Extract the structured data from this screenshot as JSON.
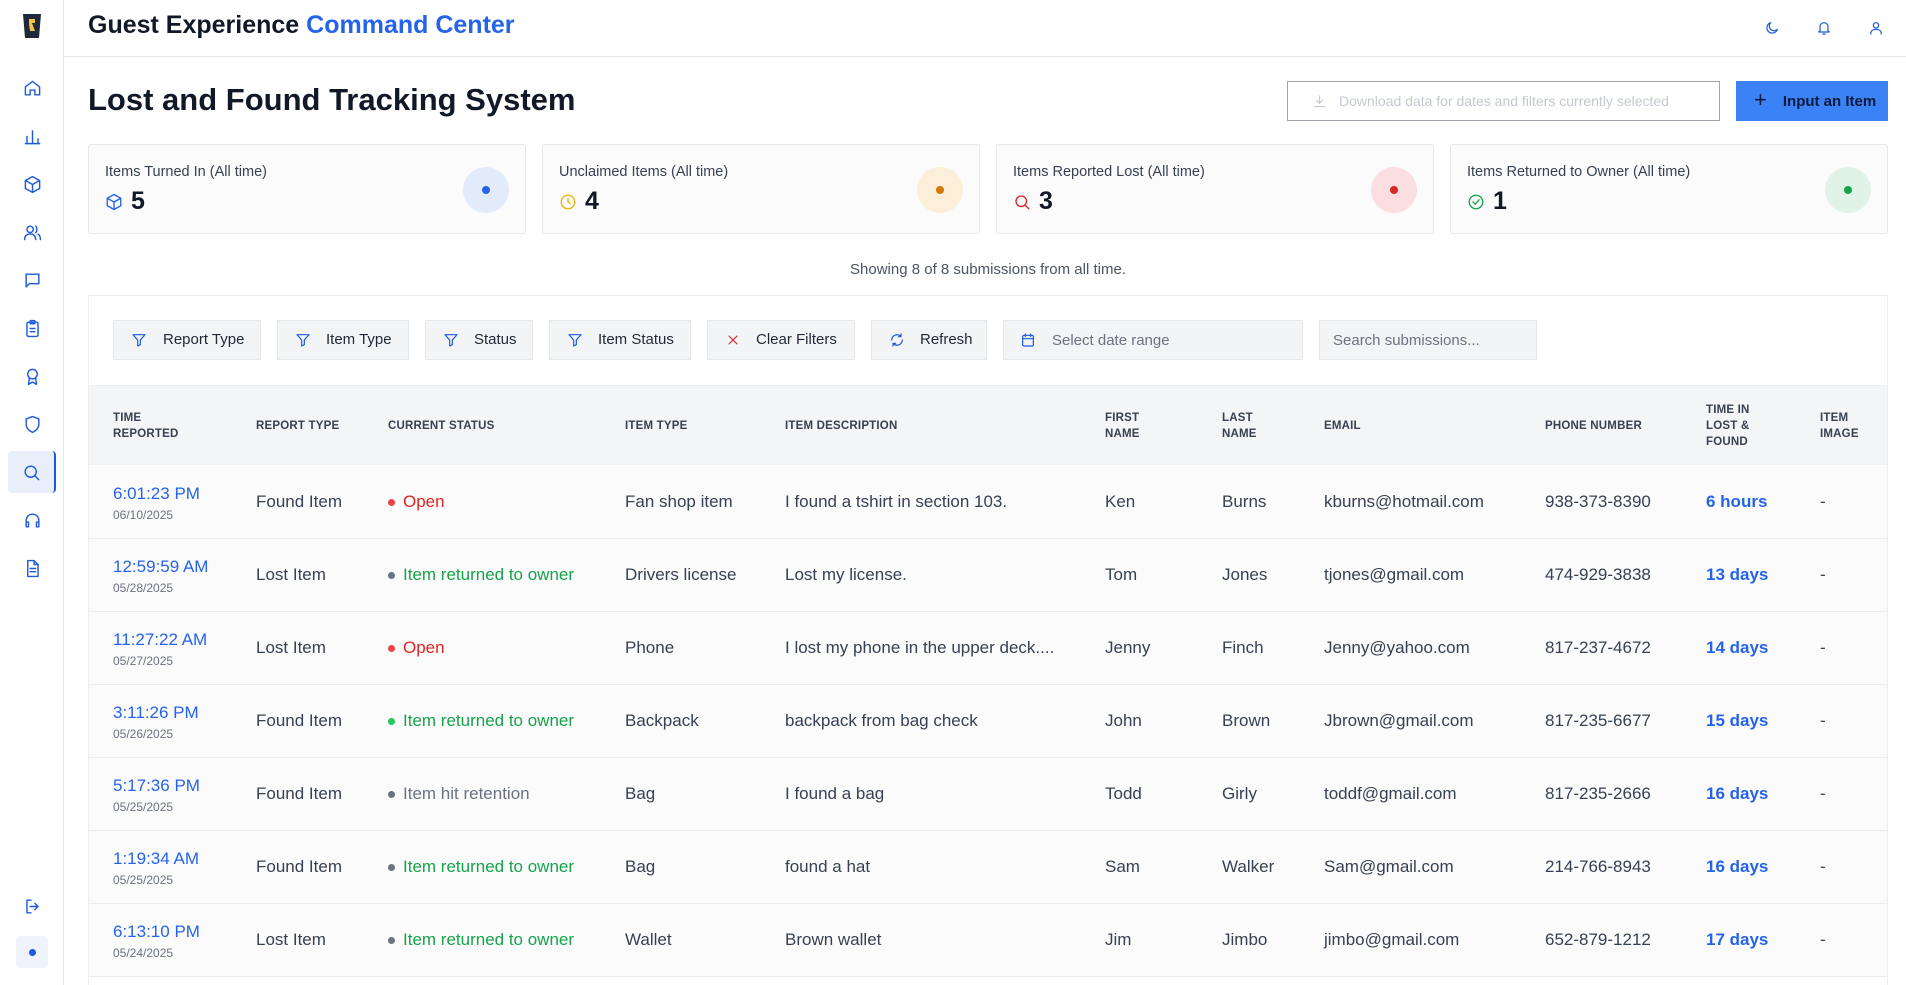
{
  "header": {
    "title_part1": "Guest Experience",
    "title_part2": "Command Center"
  },
  "sidebar": {
    "items": [
      {
        "icon": "home-icon"
      },
      {
        "icon": "bar-chart-icon"
      },
      {
        "icon": "box-icon"
      },
      {
        "icon": "users-icon"
      },
      {
        "icon": "message-icon"
      },
      {
        "icon": "clipboard-icon"
      },
      {
        "icon": "award-icon"
      },
      {
        "icon": "shield-icon"
      },
      {
        "icon": "search-icon",
        "active": true
      },
      {
        "icon": "headphones-icon"
      },
      {
        "icon": "file-text-icon"
      }
    ],
    "logout_icon": "logout-icon"
  },
  "page": {
    "title": "Lost and Found Tracking System",
    "download_label": "Download data for dates and filters currently selected",
    "input_item_label": "Input an Item"
  },
  "stats": [
    {
      "label": "Items Turned In (All time)",
      "value": "5",
      "color": "#2563eb",
      "icon": "box-icon"
    },
    {
      "label": "Unclaimed Items (All time)",
      "value": "4",
      "color": "#eab308",
      "icon": "clock-icon"
    },
    {
      "label": "Items Reported Lost (All time)",
      "value": "3",
      "color": "#dc2626",
      "icon": "search-icon"
    },
    {
      "label": "Items Returned to Owner (All time)",
      "value": "1",
      "color": "#16a34a",
      "icon": "check-circle-icon"
    }
  ],
  "showing_text": "Showing 8 of 8 submissions from all time.",
  "filters": {
    "report_type": "Report Type",
    "item_type": "Item Type",
    "status": "Status",
    "item_status": "Item Status",
    "clear": "Clear Filters",
    "refresh": "Refresh",
    "date_placeholder": "Select date range",
    "search_placeholder": "Search submissions..."
  },
  "table": {
    "headers": {
      "time": "Time Reported",
      "report_type": "Report Type",
      "status": "Current Status",
      "item_type": "Item Type",
      "description": "Item Description",
      "first": "First Name",
      "last": "Last Name",
      "email": "Email",
      "phone": "Phone Number",
      "time_in": "Time in Lost & Found",
      "image": "Item Image"
    },
    "rows": [
      {
        "time": "6:01:23 PM",
        "date": "06/10/2025",
        "report_type": "Found Item",
        "status": "Open",
        "status_color": "#dc2626",
        "dot_color": "#ef4444",
        "item_type": "Fan shop item",
        "description": "I found a tshirt in section 103.",
        "first": "Ken",
        "last": "Burns",
        "email": "kburns@hotmail.com",
        "phone": "938-373-8390",
        "time_in": "6 hours",
        "image": "-"
      },
      {
        "time": "12:59:59 AM",
        "date": "05/28/2025",
        "report_type": "Lost Item",
        "status": "Item returned to owner",
        "status_color": "#16a34a",
        "dot_color": "#6b7280",
        "item_type": "Drivers license",
        "description": "Lost my license.",
        "first": "Tom",
        "last": "Jones",
        "email": "tjones@gmail.com",
        "phone": "474-929-3838",
        "time_in": "13 days",
        "image": "-"
      },
      {
        "time": "11:27:22 AM",
        "date": "05/27/2025",
        "report_type": "Lost Item",
        "status": "Open",
        "status_color": "#dc2626",
        "dot_color": "#ef4444",
        "item_type": "Phone",
        "description": "I lost my phone in the upper deck....",
        "first": "Jenny",
        "last": "Finch",
        "email": "Jenny@yahoo.com",
        "phone": "817-237-4672",
        "time_in": "14 days",
        "image": "-"
      },
      {
        "time": "3:11:26 PM",
        "date": "05/26/2025",
        "report_type": "Found Item",
        "status": "Item returned to owner",
        "status_color": "#16a34a",
        "dot_color": "#22c55e",
        "item_type": "Backpack",
        "description": "backpack from bag check",
        "first": "John",
        "last": "Brown",
        "email": "Jbrown@gmail.com",
        "phone": "817-235-6677",
        "time_in": "15 days",
        "image": "-"
      },
      {
        "time": "5:17:36 PM",
        "date": "05/25/2025",
        "report_type": "Found Item",
        "status": "Item hit retention",
        "status_color": "#6b7280",
        "dot_color": "#6b7280",
        "item_type": "Bag",
        "description": "I found a bag",
        "first": "Todd",
        "last": "Girly",
        "email": "toddf@gmail.com",
        "phone": "817-235-2666",
        "time_in": "16 days",
        "image": "-"
      },
      {
        "time": "1:19:34 AM",
        "date": "05/25/2025",
        "report_type": "Found Item",
        "status": "Item returned to owner",
        "status_color": "#16a34a",
        "dot_color": "#6b7280",
        "item_type": "Bag",
        "description": "found a hat",
        "first": "Sam",
        "last": "Walker",
        "email": "Sam@gmail.com",
        "phone": "214-766-8943",
        "time_in": "16 days",
        "image": "-"
      },
      {
        "time": "6:13:10 PM",
        "date": "05/24/2025",
        "report_type": "Lost Item",
        "status": "Item returned to owner",
        "status_color": "#16a34a",
        "dot_color": "#6b7280",
        "item_type": "Wallet",
        "description": "Brown wallet",
        "first": "Jim",
        "last": "Jimbo",
        "email": "jimbo@gmail.com",
        "phone": "652-879-1212",
        "time_in": "17 days",
        "image": "-"
      }
    ]
  }
}
